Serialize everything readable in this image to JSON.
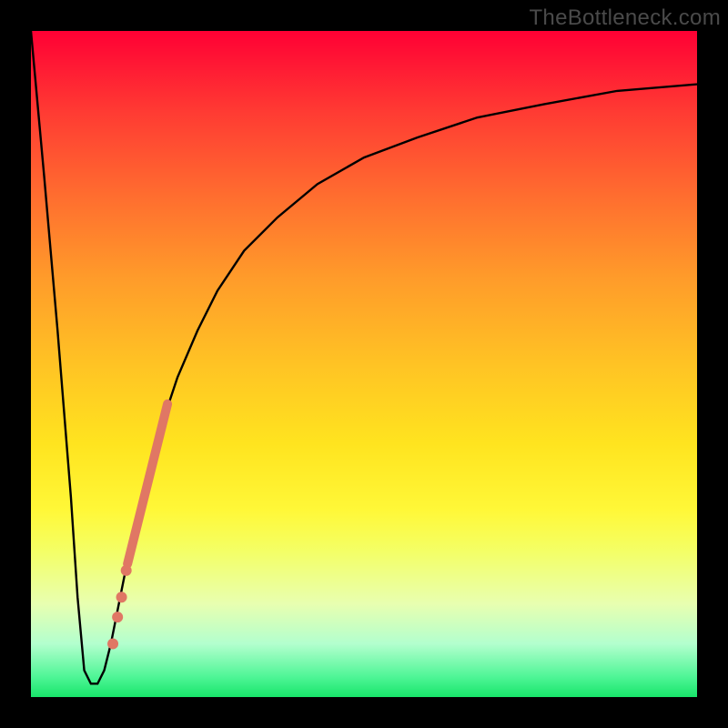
{
  "watermark": "TheBottleneck.com",
  "chart_data": {
    "type": "line",
    "title": "",
    "xlabel": "",
    "ylabel": "",
    "xlim": [
      0,
      100
    ],
    "ylim": [
      0,
      100
    ],
    "background_gradient": {
      "orientation": "vertical",
      "stops": [
        {
          "pos": 0,
          "color": "#18e56a"
        },
        {
          "pos": 3,
          "color": "#4ef596"
        },
        {
          "pos": 8,
          "color": "#b3ffce"
        },
        {
          "pos": 14,
          "color": "#e8ffb0"
        },
        {
          "pos": 22,
          "color": "#f4ff65"
        },
        {
          "pos": 28,
          "color": "#fff838"
        },
        {
          "pos": 38,
          "color": "#ffe41f"
        },
        {
          "pos": 50,
          "color": "#ffc324"
        },
        {
          "pos": 63,
          "color": "#ff9b2a"
        },
        {
          "pos": 75,
          "color": "#ff6e2f"
        },
        {
          "pos": 88,
          "color": "#ff3a33"
        },
        {
          "pos": 100,
          "color": "#ff0034"
        }
      ]
    },
    "series": [
      {
        "name": "bottleneck-curve",
        "color": "#000000",
        "x": [
          0,
          2,
          4,
          6,
          7,
          8,
          9,
          10,
          11,
          12,
          14,
          16,
          18,
          20,
          22,
          25,
          28,
          32,
          37,
          43,
          50,
          58,
          67,
          77,
          88,
          100
        ],
        "y": [
          100,
          78,
          55,
          30,
          15,
          4,
          2,
          2,
          4,
          8,
          18,
          27,
          35,
          42,
          48,
          55,
          61,
          67,
          72,
          77,
          81,
          84,
          87,
          89,
          91,
          92
        ]
      }
    ],
    "highlight_segment": {
      "name": "highlight-stroke",
      "color": "#e07764",
      "width": 10,
      "x": [
        14.5,
        20.5
      ],
      "y": [
        20,
        44
      ]
    },
    "highlight_points": {
      "name": "highlight-dots",
      "color": "#e07764",
      "radius": 6,
      "points": [
        {
          "x": 14.3,
          "y": 19
        },
        {
          "x": 13.6,
          "y": 15
        },
        {
          "x": 13.0,
          "y": 12
        },
        {
          "x": 12.3,
          "y": 8
        }
      ]
    }
  }
}
